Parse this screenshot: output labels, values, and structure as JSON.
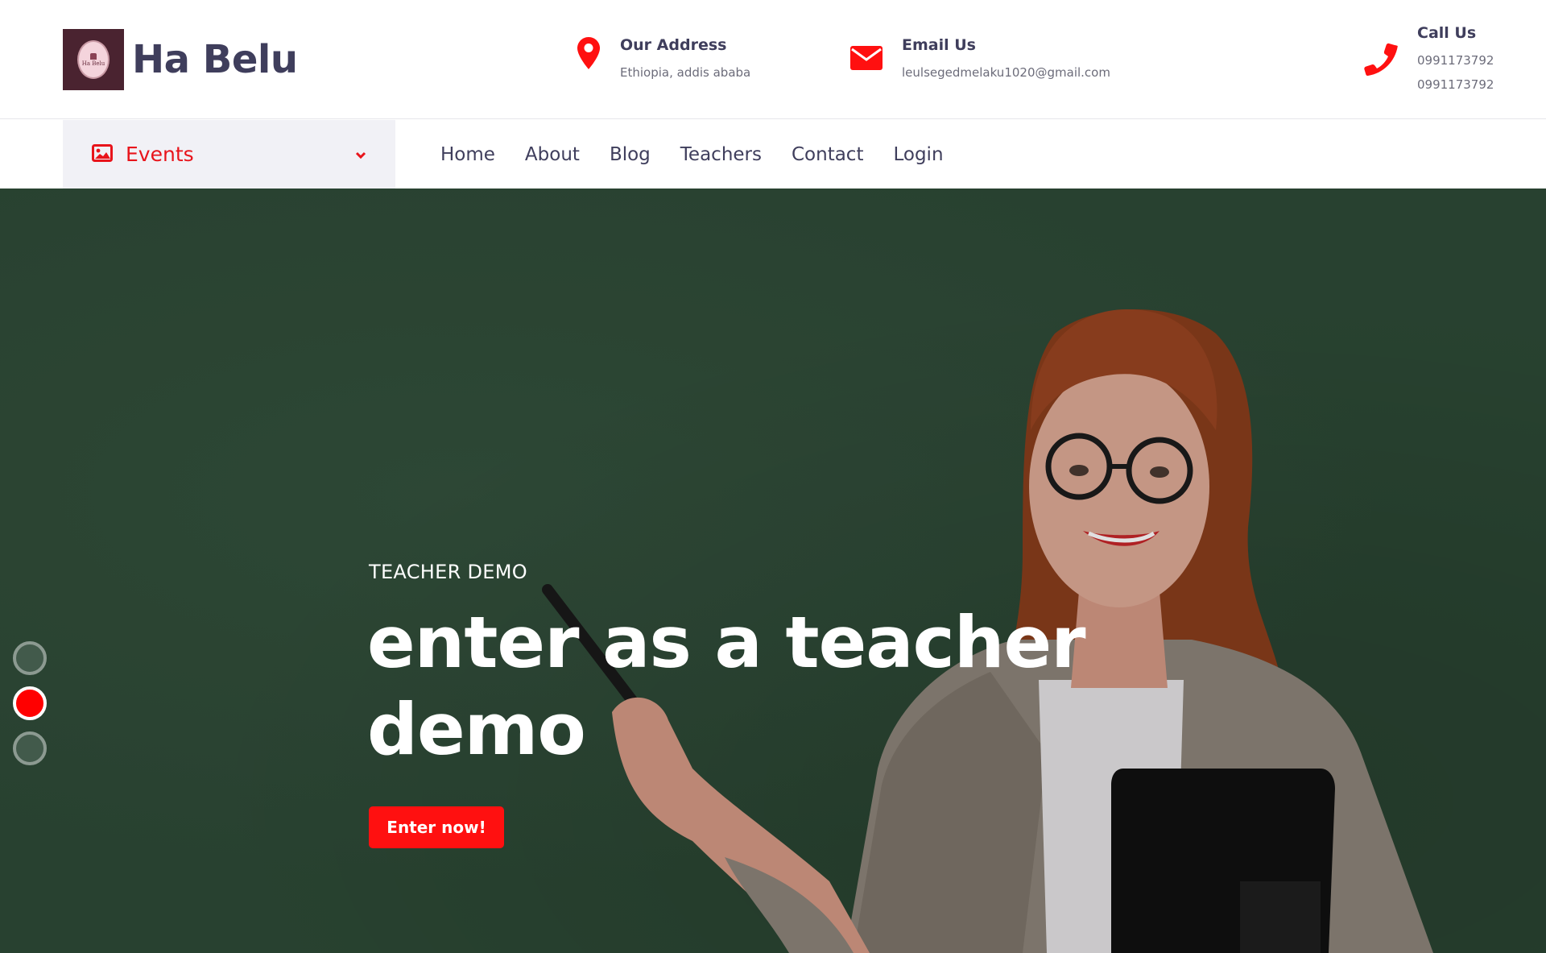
{
  "brand": {
    "name": "Ha Belu",
    "logo_text": "Ha Belu"
  },
  "contact": {
    "address": {
      "label": "Our Address",
      "value": "Ethiopia, addis ababa",
      "icon": "map-pin-icon"
    },
    "email": {
      "label": "Email Us",
      "value": "leulsegedmelaku1020@gmail.com",
      "icon": "envelope-icon"
    },
    "call": {
      "label": "Call Us",
      "values": [
        "0991173792",
        "0991173792"
      ],
      "icon": "phone-icon"
    }
  },
  "nav": {
    "category": {
      "label": "Events",
      "icon": "image-icon"
    },
    "items": [
      {
        "label": "Home"
      },
      {
        "label": "About"
      },
      {
        "label": "Blog"
      },
      {
        "label": "Teachers"
      },
      {
        "label": "Contact"
      },
      {
        "label": "Login"
      }
    ]
  },
  "hero": {
    "eyebrow": "TEACHER DEMO",
    "headline": "enter as a teacher demo",
    "cta_label": "Enter now!",
    "slides": {
      "count": 3,
      "active": 2
    }
  },
  "colors": {
    "accent": "#ff1010",
    "text_dark": "#3f3e5c",
    "hero_bg": "#2e4b37",
    "category_bg": "#f1f1f6"
  }
}
